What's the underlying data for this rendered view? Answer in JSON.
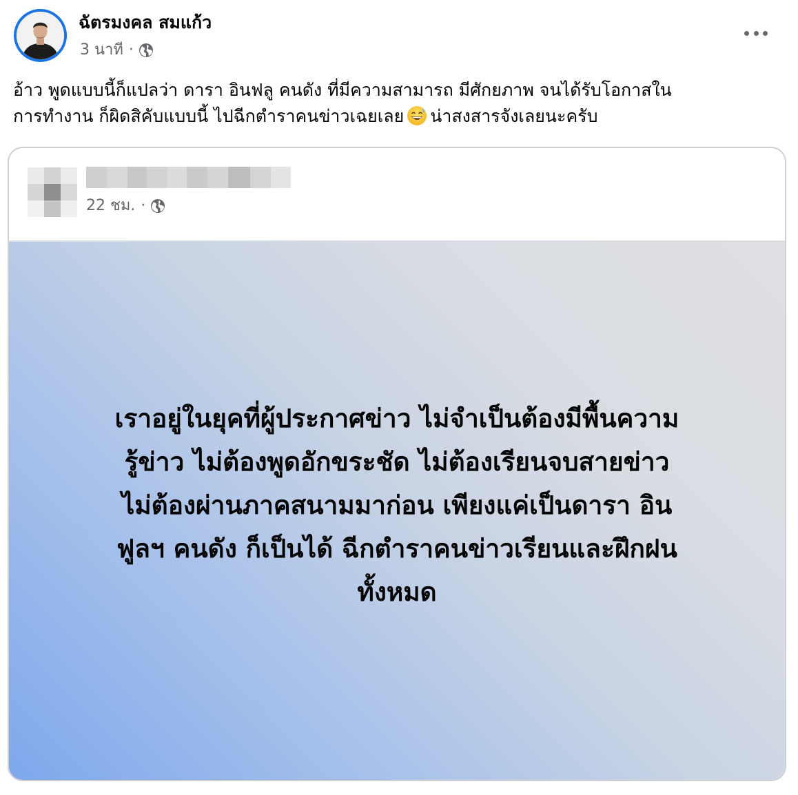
{
  "post": {
    "author": "ฉัตรมงคล สมแก้ว",
    "time": "3 นาที",
    "separator": "·",
    "text_lines": [
      "อ้าว พูดแบบนี้ก็แปลว่า ดารา อินฟลู คนดัง ที่มีความสามารถ มีศักยภาพ จนได้รับโอกาสใน",
      "การทำงาน ก็ผิดสิคับแบบนี้ ไปฉีกตำราคนข่าวเฉยเลย",
      "น่าสงสารจังเลยนะครับ"
    ],
    "emoji": "grinning-face-with-sweat",
    "more_icon": "more-horizontal-icon",
    "audience_icon": "globe-icon"
  },
  "shared_post": {
    "author": "",
    "time": "22 ชม.",
    "separator": "·",
    "audience_icon": "globe-icon",
    "background_colors": [
      "#7ea8ec",
      "#c8d3e4",
      "#dedfe2"
    ],
    "text_lines": [
      "เราอยู่ในยุคที่ผู้ประกาศข่าว ไม่จำเป็นต้องมีพื้นความ",
      "รู้ข่าว ไม่ต้องพูดอักขระชัด ไม่ต้องเรียนจบสายข่าว",
      "ไม่ต้องผ่านภาคสนามมาก่อน เพียงแค่เป็นดารา อิน",
      "ฟูลฯ คนดัง ก็เป็นได้ ฉีกตำราคนข่าวเรียนและฝึกฝน",
      "ทั้งหมด"
    ]
  },
  "colors": {
    "accent_ring": "#1b74e4",
    "secondary_text": "#65676b",
    "primary_text": "#050505",
    "border": "#ced0d4"
  }
}
